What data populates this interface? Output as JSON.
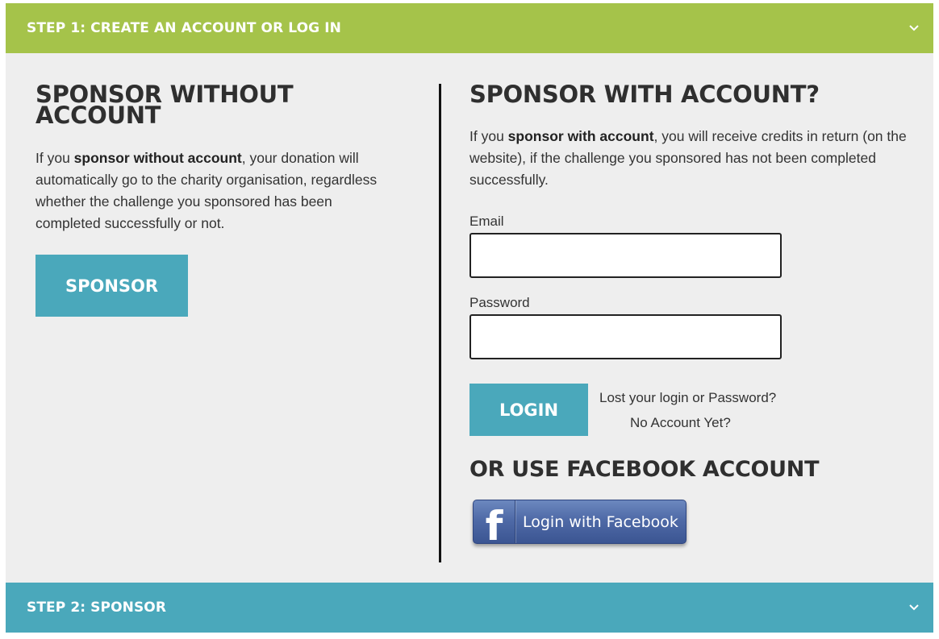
{
  "steps": {
    "step1_title": "STEP 1: CREATE AN ACCOUNT OR LOG IN",
    "step2_title": "STEP 2: SPONSOR"
  },
  "left": {
    "heading": "SPONSOR WITHOUT ACCOUNT",
    "para_prefix": "If you ",
    "para_bold": "sponsor without account",
    "para_suffix": ", your donation will automatically go to the charity organisation, regardless whether the challenge you sponsored has been completed successfully or not.",
    "sponsor_button": "SPONSOR"
  },
  "right": {
    "heading": "SPONSOR WITH ACCOUNT?",
    "para_prefix": "If you ",
    "para_bold": "sponsor with account",
    "para_suffix": ", you will receive credits in return (on the website), if the challenge you sponsored has not been completed successfully.",
    "email_label": "Email",
    "email_value": "",
    "password_label": "Password",
    "password_value": "",
    "login_button": "LOGIN",
    "lost_link": "Lost your login or Password?",
    "no_account_link": "No Account Yet?",
    "facebook_heading": "OR USE FACEBOOK ACCOUNT",
    "facebook_logo_letter": "f",
    "facebook_button": "Login with Facebook"
  },
  "colors": {
    "step1_bar": "#a5c34a",
    "step2_bar": "#4aa8bb",
    "button": "#4aa8bb",
    "panel_bg": "#eeeeee",
    "facebook_blue": "#4f6aa7"
  },
  "icons": {
    "step1_toggle": "chevron-down-icon",
    "step2_toggle": "chevron-down-icon",
    "facebook": "facebook-f-icon"
  }
}
